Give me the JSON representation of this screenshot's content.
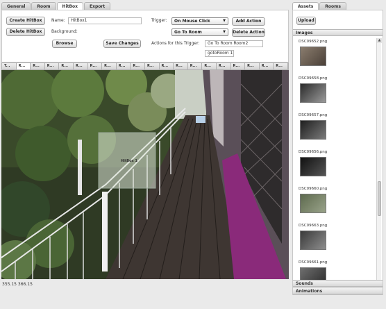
{
  "editor_tabs": [
    "General",
    "Room",
    "HitBox",
    "Export"
  ],
  "hitbox": {
    "create_label": "Create HitBox",
    "delete_label": "Delete HitBox",
    "name_label": "Name:",
    "name_value": "HitBox1",
    "background_label": "Background:",
    "browse_label": "Browse",
    "save_label": "Save Changes",
    "trigger_label": "Trigger:",
    "trigger_value": "On Mouse Click",
    "action_value": "Go To Room",
    "add_action_label": "Add Action",
    "delete_action_label": "Delete Action",
    "actions_label": "Actions for this Trigger:",
    "action_param_value": "Go To Room Room2",
    "action_list_item": "gotoRoom 1"
  },
  "thumb_strip": [
    "T...",
    "R...",
    "R...",
    "R...",
    "R...",
    "R...",
    "R...",
    "R...",
    "R...",
    "R...",
    "R...",
    "R...",
    "R...",
    "R...",
    "R...",
    "R...",
    "R...",
    "R...",
    "R...",
    "R..."
  ],
  "canvas": {
    "hitbox_label": "HitBox 1",
    "coords": "355.15 366.15"
  },
  "assets": {
    "tabs": [
      "Assets",
      "Rooms"
    ],
    "upload_label": "Upload",
    "images_header": "Images",
    "items": [
      {
        "name": "DSC09652.png"
      },
      {
        "name": "DSC09658.png"
      },
      {
        "name": "DSC09657.png"
      },
      {
        "name": "DSC09656.png"
      },
      {
        "name": "DSC09660.png"
      },
      {
        "name": "DSC09663.png"
      },
      {
        "name": "DSC09661.png"
      }
    ],
    "sounds_header": "Sounds",
    "animations_header": "Animations"
  },
  "colors": {
    "highlight_purple": "#8a2a7a",
    "panel_bg": "#ffffff",
    "app_bg": "#eaeaea"
  }
}
